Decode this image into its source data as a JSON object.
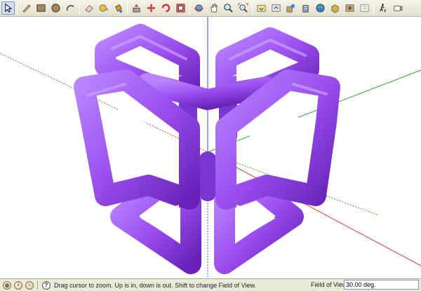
{
  "toolbar": {
    "tools": [
      {
        "name": "select-tool-icon",
        "active": true
      },
      {
        "name": "pencil-line-tool-icon"
      },
      {
        "name": "rectangle-tool-icon"
      },
      {
        "name": "circle-tool-icon"
      },
      {
        "name": "arc-tool-icon"
      },
      {
        "name": "eraser-tool-icon"
      },
      {
        "name": "tape-measure-tool-icon"
      },
      {
        "name": "paint-bucket-tool-icon"
      },
      {
        "name": "push-pull-tool-icon"
      },
      {
        "name": "move-tool-icon"
      },
      {
        "name": "rotate-tool-icon"
      },
      {
        "name": "offset-tool-icon"
      },
      {
        "name": "orbit-tool-icon"
      },
      {
        "name": "pan-tool-icon"
      },
      {
        "name": "zoom-tool-icon"
      },
      {
        "name": "zoom-extents-tool-icon"
      },
      {
        "name": "get-models-icon"
      },
      {
        "name": "share-model-icon"
      },
      {
        "name": "geo-location-icon"
      },
      {
        "name": "add-building-icon"
      },
      {
        "name": "preview-in-earth-icon"
      },
      {
        "name": "components-icon"
      },
      {
        "name": "get-photo-texture-icon"
      },
      {
        "name": "extension-warehouse-icon"
      },
      {
        "name": "walk-tool-icon"
      },
      {
        "name": "position-camera-tool-icon"
      }
    ]
  },
  "colors": {
    "model_fill": "#9b4fef",
    "axis_red": "#d94040",
    "axis_green": "#2fa82f",
    "axis_blue": "#3a4bd8"
  },
  "status": {
    "message": "Drag cursor to zoom.  Up is in, down is out. Shift to change Field of View.",
    "vcb_label": "Field of View",
    "vcb_value": "30.00 deg."
  }
}
